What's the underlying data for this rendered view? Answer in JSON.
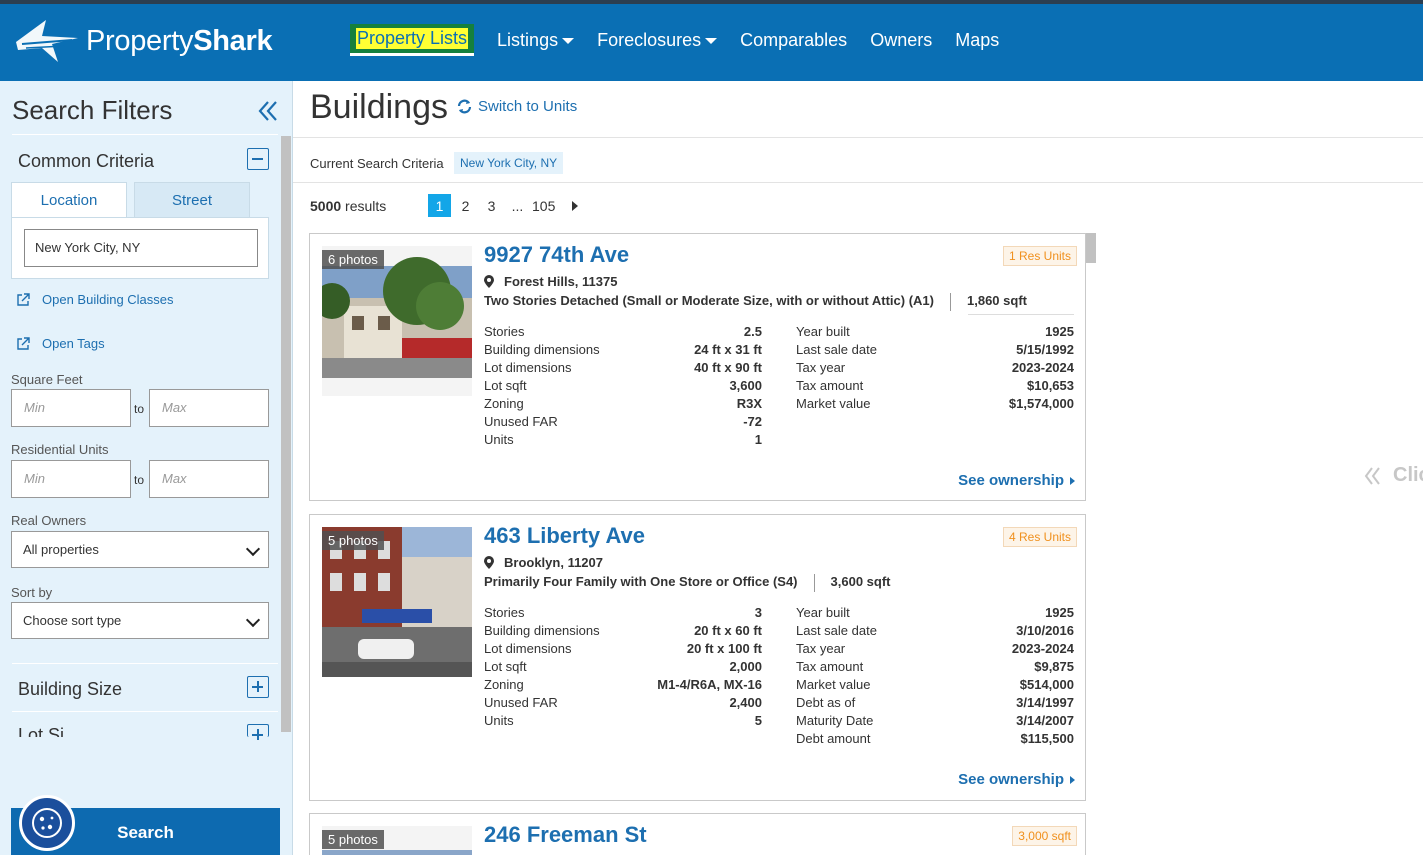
{
  "brand": {
    "light": "Property",
    "bold": "Shark"
  },
  "nav": [
    {
      "label": "Property Lists",
      "active": true,
      "dropdown": false
    },
    {
      "label": "Listings",
      "active": false,
      "dropdown": true
    },
    {
      "label": "Foreclosures",
      "active": false,
      "dropdown": true
    },
    {
      "label": "Comparables",
      "active": false,
      "dropdown": false
    },
    {
      "label": "Owners",
      "active": false,
      "dropdown": false
    },
    {
      "label": "Maps",
      "active": false,
      "dropdown": false
    }
  ],
  "sidebar": {
    "title": "Search Filters",
    "common_criteria": "Common Criteria",
    "tabs": {
      "location": "Location",
      "street": "Street"
    },
    "location_value": "New York City, NY",
    "open_building_classes": "Open Building Classes",
    "open_tags": "Open Tags",
    "square_feet": {
      "label": "Square Feet",
      "min_placeholder": "Min",
      "max_placeholder": "Max",
      "to": "to"
    },
    "residential_units": {
      "label": "Residential Units",
      "min_placeholder": "Min",
      "max_placeholder": "Max",
      "to": "to"
    },
    "real_owners": {
      "label": "Real Owners",
      "value": "All properties"
    },
    "sort_by": {
      "label": "Sort by",
      "value": "Choose sort type"
    },
    "building_size": "Building Size",
    "lot_size": "Lot Si...",
    "search_button": "Search"
  },
  "main": {
    "title": "Buildings",
    "switch_link": "Switch to Units",
    "criteria_label": "Current Search Criteria",
    "criteria_tag": "New York City, NY",
    "results_count": "5000",
    "results_label": "results",
    "pages": [
      "1",
      "2",
      "3",
      "...",
      "105"
    ],
    "current_page": "1",
    "see_ownership": "See ownership",
    "side_hint": "Clic"
  },
  "listings": [
    {
      "photos": "6 photos",
      "address": "9927 74th Ave",
      "badge": "1 Res Units",
      "city": "Forest Hills, 11375",
      "class": "Two Stories Detached (Small or Moderate Size, with or without Attic) (A1)",
      "sqft": "1,860 sqft",
      "left": [
        {
          "k": "Stories",
          "v": "2.5"
        },
        {
          "k": "Building dimensions",
          "v": "24 ft x 31 ft"
        },
        {
          "k": "Lot dimensions",
          "v": "40 ft x 90 ft"
        },
        {
          "k": "Lot sqft",
          "v": "3,600"
        },
        {
          "k": "Zoning",
          "v": "R3X"
        },
        {
          "k": "Unused FAR",
          "v": "-72"
        },
        {
          "k": "Units",
          "v": "1"
        }
      ],
      "right": [
        {
          "k": "Year built",
          "v": "1925"
        },
        {
          "k": "Last sale date",
          "v": "5/15/1992"
        },
        {
          "k": "Tax year",
          "v": "2023-2024"
        },
        {
          "k": "Tax amount",
          "v": "$10,653"
        },
        {
          "k": "Market value",
          "v": "$1,574,000"
        }
      ]
    },
    {
      "photos": "5 photos",
      "address": "463 Liberty Ave",
      "badge": "4 Res Units",
      "city": "Brooklyn, 11207",
      "class": "Primarily Four Family with One Store or Office (S4)",
      "sqft": "3,600 sqft",
      "left": [
        {
          "k": "Stories",
          "v": "3"
        },
        {
          "k": "Building dimensions",
          "v": "20 ft x 60 ft"
        },
        {
          "k": "Lot dimensions",
          "v": "20 ft x 100 ft"
        },
        {
          "k": "Lot sqft",
          "v": "2,000"
        },
        {
          "k": "Zoning",
          "v": "M1-4/R6A, MX-16"
        },
        {
          "k": "Unused FAR",
          "v": "2,400"
        },
        {
          "k": "Units",
          "v": "5"
        }
      ],
      "right": [
        {
          "k": "Year built",
          "v": "1925"
        },
        {
          "k": "Last sale date",
          "v": "3/10/2016"
        },
        {
          "k": "Tax year",
          "v": "2023-2024"
        },
        {
          "k": "Tax amount",
          "v": "$9,875"
        },
        {
          "k": "Market value",
          "v": "$514,000"
        },
        {
          "k": "Debt as of",
          "v": "3/14/1997"
        },
        {
          "k": "Maturity Date",
          "v": "3/14/2007"
        },
        {
          "k": "Debt amount",
          "v": "$115,500"
        }
      ]
    },
    {
      "photos": "5 photos",
      "address": "246 Freeman St",
      "badge": "3,000 sqft"
    }
  ]
}
